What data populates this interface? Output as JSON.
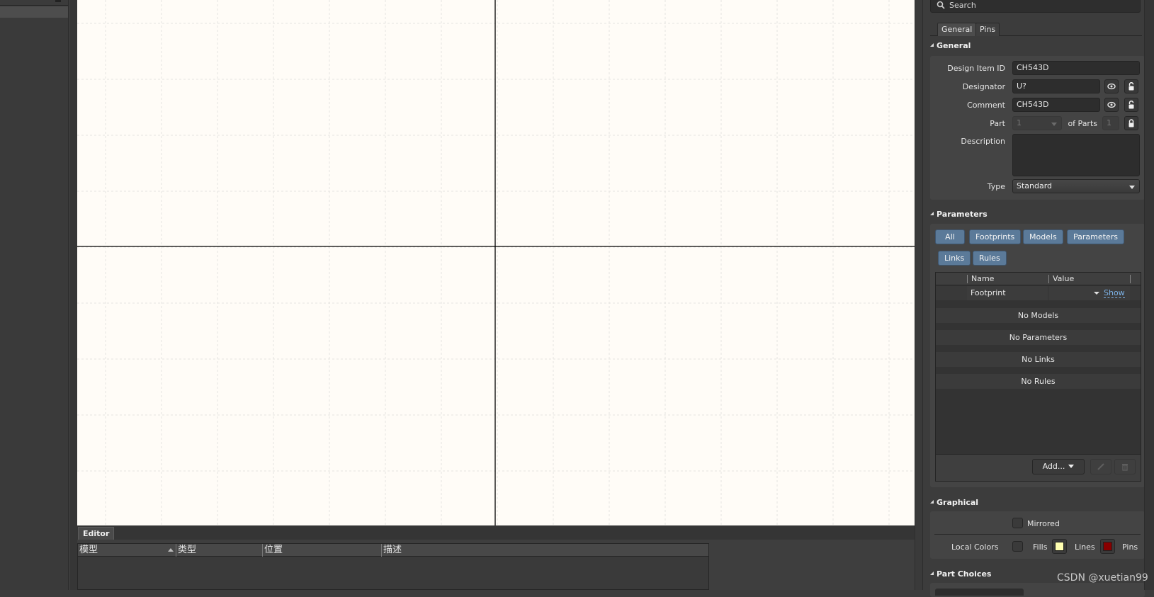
{
  "canvas": {
    "background": "#fffcf7",
    "grid_color": "#e6e4e0",
    "crosshair_color": "#000000"
  },
  "editor": {
    "tab_label": "Editor",
    "columns": [
      "模型",
      "类型",
      "位置",
      "描述"
    ]
  },
  "properties": {
    "search_placeholder": "Search",
    "tabs": [
      "General",
      "Pins"
    ],
    "general": {
      "title": "General",
      "design_item_id_label": "Design Item ID",
      "design_item_id_value": "CH543D",
      "designator_label": "Designator",
      "designator_value": "U?",
      "comment_label": "Comment",
      "comment_value": "CH543D",
      "part_label": "Part",
      "part_value": "1",
      "of_parts_label": "of Parts",
      "of_parts_value": "1",
      "description_label": "Description",
      "description_value": "",
      "type_label": "Type",
      "type_value": "Standard"
    },
    "parameters": {
      "title": "Parameters",
      "filters": [
        "All",
        "Footprints",
        "Models",
        "Parameters",
        "Links",
        "Rules"
      ],
      "columns": [
        "Name",
        "Value"
      ],
      "footprint_row": {
        "name": "Footprint",
        "value": "",
        "link": "Show"
      },
      "empty_rows": [
        "No Models",
        "No Parameters",
        "No Links",
        "No Rules"
      ],
      "add_label": "Add..."
    },
    "graphical": {
      "title": "Graphical",
      "mirrored_label": "Mirrored",
      "mirrored_checked": false,
      "local_colors_label": "Local Colors",
      "local_colors_checked": false,
      "fills_label": "Fills",
      "fills_color": "#ffffb0",
      "lines_label": "Lines",
      "lines_color": "#880000",
      "pins_label": "Pins"
    },
    "part_choices": {
      "title": "Part Choices"
    }
  },
  "accent_colors": {
    "filter_chip": "#5b7a99",
    "link": "#7db3e8"
  },
  "watermark": "CSDN @xuetian99"
}
